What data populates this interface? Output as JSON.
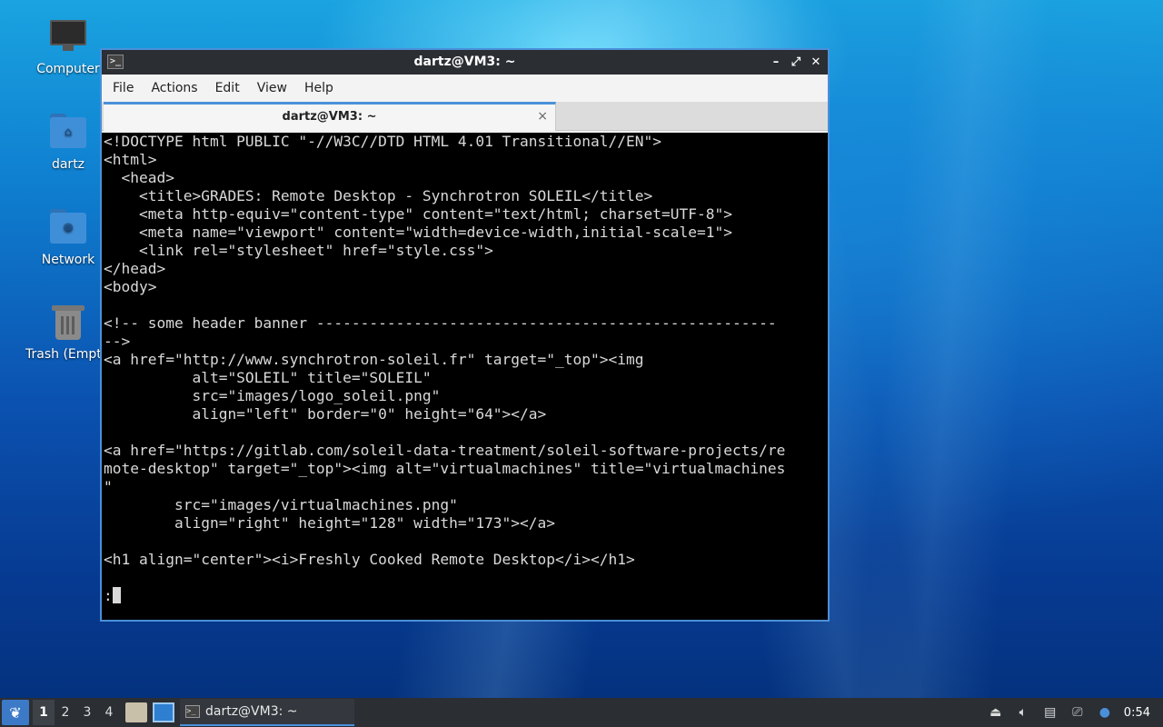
{
  "desktop": {
    "icons": [
      {
        "label": "Computer",
        "icon": "computer-icon"
      },
      {
        "label": "dartz",
        "icon": "home-folder-icon"
      },
      {
        "label": "Network",
        "icon": "network-folder-icon"
      },
      {
        "label": "Trash (Empt",
        "icon": "trash-icon"
      }
    ]
  },
  "window": {
    "title": "dartz@VM3: ~",
    "menu": [
      "File",
      "Actions",
      "Edit",
      "View",
      "Help"
    ],
    "tab_label": "dartz@VM3: ~",
    "tab_close": "×",
    "accent": "#4a90d9",
    "terminal_lines": [
      "<!DOCTYPE html PUBLIC \"-//W3C//DTD HTML 4.01 Transitional//EN\">",
      "<html>",
      "  <head>",
      "    <title>GRADES: Remote Desktop - Synchrotron SOLEIL</title>",
      "    <meta http-equiv=\"content-type\" content=\"text/html; charset=UTF-8\">",
      "    <meta name=\"viewport\" content=\"width=device-width,initial-scale=1\">",
      "    <link rel=\"stylesheet\" href=\"style.css\">",
      "</head>",
      "<body>",
      "",
      "<!-- some header banner ----------------------------------------------------",
      "-->",
      "<a href=\"http://www.synchrotron-soleil.fr\" target=\"_top\"><img",
      "          alt=\"SOLEIL\" title=\"SOLEIL\"",
      "          src=\"images/logo_soleil.png\"",
      "          align=\"left\" border=\"0\" height=\"64\"></a>",
      "",
      "<a href=\"https://gitlab.com/soleil-data-treatment/soleil-software-projects/re",
      "mote-desktop\" target=\"_top\"><img alt=\"virtualmachines\" title=\"virtualmachines",
      "\"",
      "        src=\"images/virtualmachines.png\"",
      "        align=\"right\" height=\"128\" width=\"173\"></a>",
      "",
      "<h1 align=\"center\"><i>Freshly Cooked Remote Desktop</i></h1>",
      "",
      ":"
    ]
  },
  "taskbar": {
    "workspaces": [
      "1",
      "2",
      "3",
      "4"
    ],
    "active_workspace": "1",
    "task_label": "dartz@VM3: ~",
    "clock": "0:54",
    "tray_icons": [
      "eject-icon",
      "volume-icon",
      "clipboard-icon",
      "network-icon",
      "notification-icon"
    ]
  }
}
